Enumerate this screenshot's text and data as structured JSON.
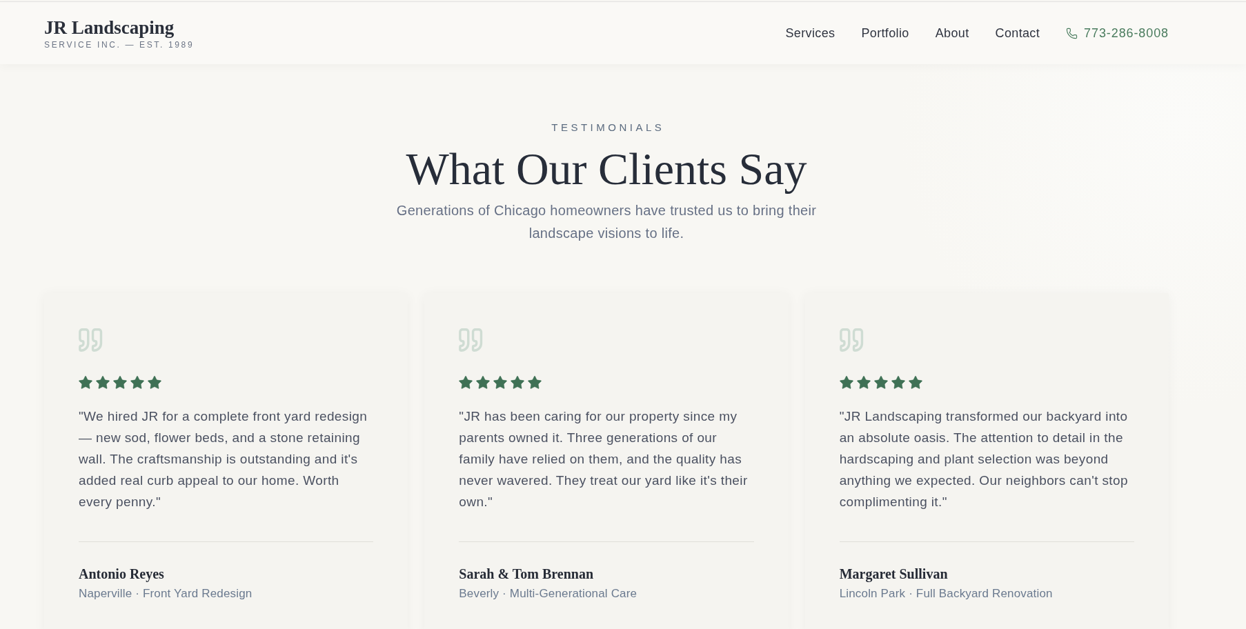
{
  "header": {
    "brand": {
      "name": "JR Landscaping",
      "tagline": "SERVICE INC. — EST. 1989"
    },
    "nav": [
      {
        "label": "Services"
      },
      {
        "label": "Portfolio"
      },
      {
        "label": "About"
      },
      {
        "label": "Contact"
      }
    ],
    "phone": "773-286-8008"
  },
  "section": {
    "eyebrow": "TESTIMONIALS",
    "title": "What Our Clients Say",
    "subtitle": "Generations of Chicago homeowners have trusted us to bring their landscape visions to life."
  },
  "testimonials": [
    {
      "stars": 5,
      "quote": "\"We hired JR for a complete front yard redesign — new sod, flower beds, and a stone retaining wall. The craftsmanship is outstanding and it's added real curb appeal to our home. Worth every penny.\"",
      "name": "Antonio Reyes",
      "detail": "Naperville · Front Yard Redesign"
    },
    {
      "stars": 5,
      "quote": "\"JR has been caring for our property since my parents owned it. Three generations of our family have relied on them, and the quality has never wavered. They treat our yard like it's their own.\"",
      "name": "Sarah & Tom Brennan",
      "detail": "Beverly · Multi-Generational Care"
    },
    {
      "stars": 5,
      "quote": "\"JR Landscaping transformed our backyard into an absolute oasis. The attention to detail in the hardscaping and plant selection was beyond anything we expected. Our neighbors can't stop complimenting it.\"",
      "name": "Margaret Sullivan",
      "detail": "Lincoln Park · Full Backyard Renovation"
    }
  ]
}
